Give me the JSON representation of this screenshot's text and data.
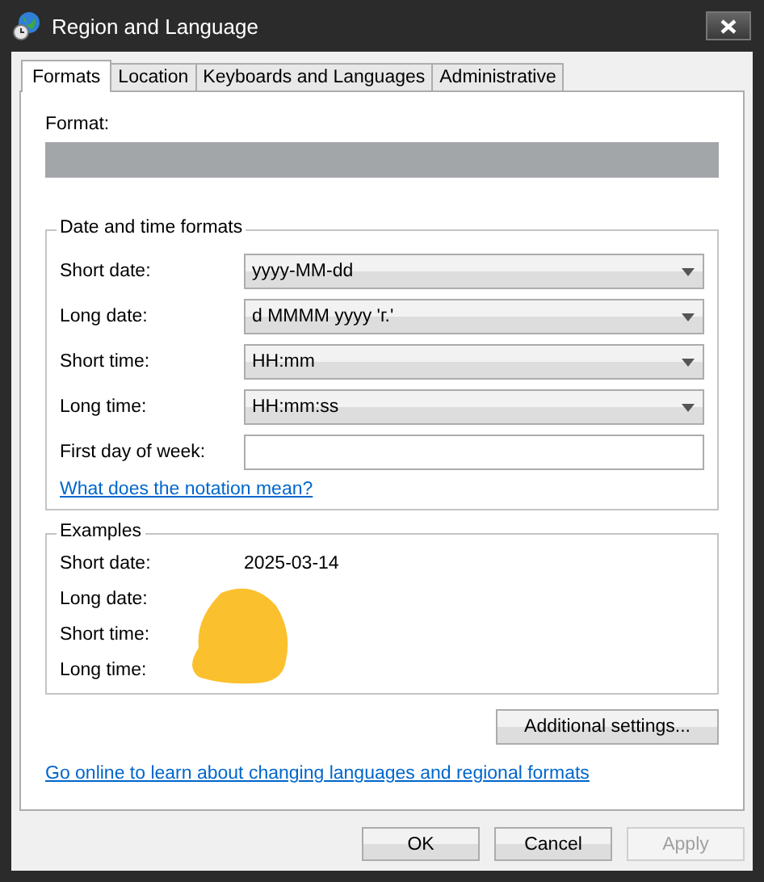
{
  "window": {
    "title": "Region and Language"
  },
  "tabs": [
    {
      "label": "Formats",
      "selected": true
    },
    {
      "label": "Location",
      "selected": false
    },
    {
      "label": "Keyboards and Languages",
      "selected": false
    },
    {
      "label": "Administrative",
      "selected": false
    }
  ],
  "format": {
    "label": "Format:"
  },
  "date_time_formats": {
    "title": "Date and time formats",
    "fields": [
      {
        "label": "Short date:",
        "kind": "dropdown",
        "value": "yyyy-MM-dd"
      },
      {
        "label": "Long date:",
        "kind": "dropdown",
        "value": "d MMMM yyyy 'г.'"
      },
      {
        "label": "Short time:",
        "kind": "dropdown",
        "value": "HH:mm"
      },
      {
        "label": "Long time:",
        "kind": "dropdown",
        "value": "HH:mm:ss"
      },
      {
        "label": "First day of week:",
        "kind": "text"
      }
    ],
    "link": "What does the notation mean?"
  },
  "examples": {
    "title": "Examples",
    "rows": [
      {
        "label": "Short date:",
        "value": "2025-03-14"
      },
      {
        "label": "Long date:"
      },
      {
        "label": "Short time:"
      },
      {
        "label": "Long time:"
      }
    ]
  },
  "additional_settings_button": "Additional settings...",
  "online_link": "Go online to learn about changing languages and regional formats",
  "buttons": [
    {
      "label": "OK",
      "disabled": false
    },
    {
      "label": "Cancel",
      "disabled": false
    },
    {
      "label": "Apply",
      "disabled": true
    }
  ]
}
